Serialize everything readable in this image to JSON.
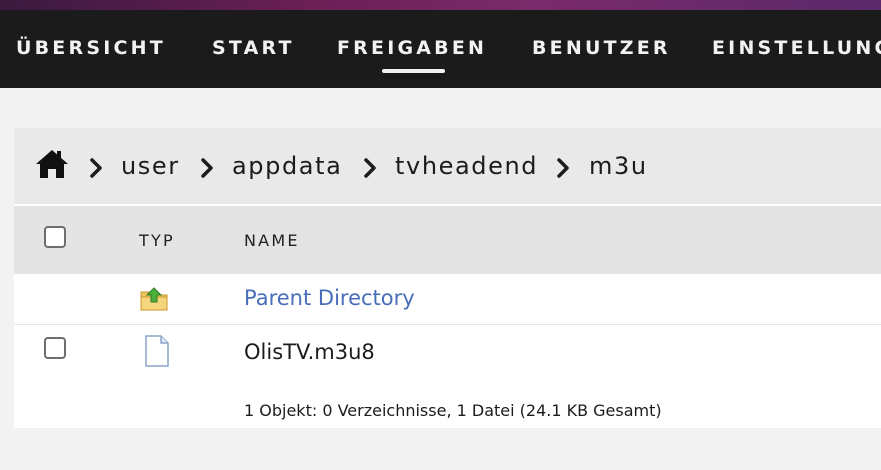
{
  "nav": {
    "items": [
      {
        "label": "ÜBERSICHT"
      },
      {
        "label": "START"
      },
      {
        "label": "FREIGABEN"
      },
      {
        "label": "BENUTZER"
      },
      {
        "label": "EINSTELLUNGEN"
      }
    ],
    "active": "FREIGABEN"
  },
  "breadcrumb": {
    "home_icon": "home-icon",
    "items": [
      "user",
      "appdata",
      "tvheadend",
      "m3u"
    ]
  },
  "table": {
    "columns": {
      "type": "TYP",
      "name": "NAME"
    },
    "parent": {
      "icon": "folder-up-icon",
      "label": "Parent Directory"
    },
    "files": [
      {
        "icon": "file-icon",
        "name": "OlisTV.m3u8"
      }
    ],
    "summary": "1 Objekt: 0 Verzeichnisse, 1 Datei (24.1 KB Gesamt)"
  },
  "colors": {
    "navbar_bg": "#1c1b1b",
    "link": "#486dba",
    "page_bg": "#f2f2f2"
  }
}
